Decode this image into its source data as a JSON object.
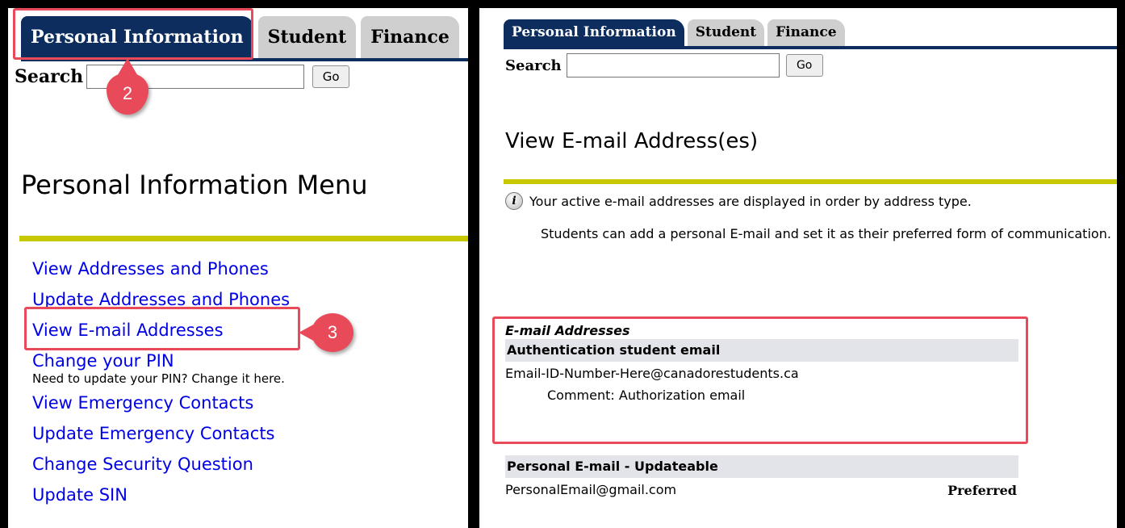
{
  "left": {
    "tabs": [
      {
        "label": "Personal Information",
        "active": true
      },
      {
        "label": "Student",
        "active": false
      },
      {
        "label": "Finance",
        "active": false
      }
    ],
    "search": {
      "label": "Search",
      "value": "",
      "go_label": "Go"
    },
    "page_title": "Personal Information Menu",
    "menu": [
      {
        "label": "View Addresses and Phones"
      },
      {
        "label": "Update Addresses and Phones"
      },
      {
        "label": "View E-mail Addresses"
      },
      {
        "label": "Change your PIN",
        "description": "Need to update your PIN? Change it here."
      },
      {
        "label": "View Emergency Contacts"
      },
      {
        "label": "Update Emergency Contacts"
      },
      {
        "label": "Change Security Question"
      },
      {
        "label": "Update SIN"
      }
    ],
    "callouts": {
      "step2": "2",
      "step3": "3"
    }
  },
  "right": {
    "tabs": [
      {
        "label": "Personal Information",
        "active": true
      },
      {
        "label": "Student",
        "active": false
      },
      {
        "label": "Finance",
        "active": false
      }
    ],
    "search": {
      "label": "Search",
      "value": "",
      "go_label": "Go"
    },
    "page_title": "View E-mail Address(es)",
    "info_text": "Your active e-mail addresses are displayed in order by address type.",
    "info_paragraph": "Students can add a personal E-mail and set it as their preferred form of communication.",
    "email_section": {
      "caption": "E-mail Addresses",
      "header": "Authentication student email",
      "email": "Email-ID-Number-Here@canadorestudents.ca",
      "comment": "Comment: Authorization email"
    },
    "personal_section": {
      "header": "Personal E-mail - Updateable",
      "email": "PersonalEmail@gmail.com",
      "status": "Preferred"
    }
  },
  "colors": {
    "tab_active": "#0d2d5e",
    "tab_inactive": "#cfcfcf",
    "rule": "#c8c800",
    "link": "#0000e6",
    "callout": "#e84a5a",
    "section_header_bg": "#e3e3ea"
  }
}
